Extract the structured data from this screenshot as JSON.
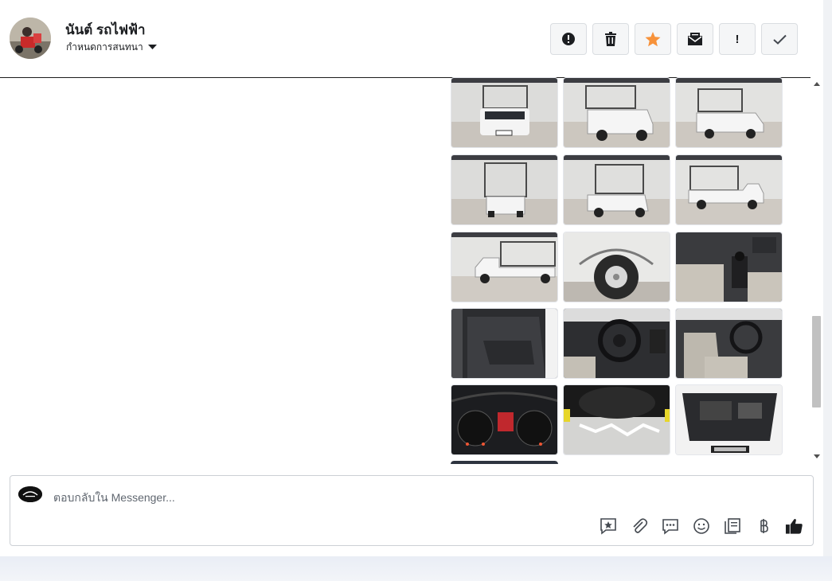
{
  "header": {
    "contact_name": "นันต์ รถไฟฟ้า",
    "assign_label": "กำหนดการสนทนา",
    "toolbar": [
      {
        "name": "report-button",
        "icon": "alert-circle-icon",
        "glyph": "!"
      },
      {
        "name": "delete-button",
        "icon": "trash-icon",
        "glyph": "🗑"
      },
      {
        "name": "star-button",
        "icon": "star-icon",
        "glyph": "★"
      },
      {
        "name": "mark-unread-button",
        "icon": "envelope-icon",
        "glyph": "✉"
      },
      {
        "name": "follow-up-button",
        "icon": "exclamation-icon",
        "glyph": "!"
      },
      {
        "name": "done-button",
        "icon": "checkmark-icon",
        "glyph": "✓"
      }
    ]
  },
  "gallery": {
    "photo_count": 16
  },
  "reply": {
    "placeholder": "ตอบกลับใน Messenger...",
    "icons": [
      "saved-reply-icon",
      "attachment-icon",
      "chat-bubble-icon",
      "emoji-icon",
      "notes-icon",
      "baht-icon",
      "thumbs-up-icon"
    ]
  },
  "colors": {
    "star": "#f7923a",
    "divider": "#1c1c1c",
    "scroll_thumb": "#c1c1c1"
  }
}
